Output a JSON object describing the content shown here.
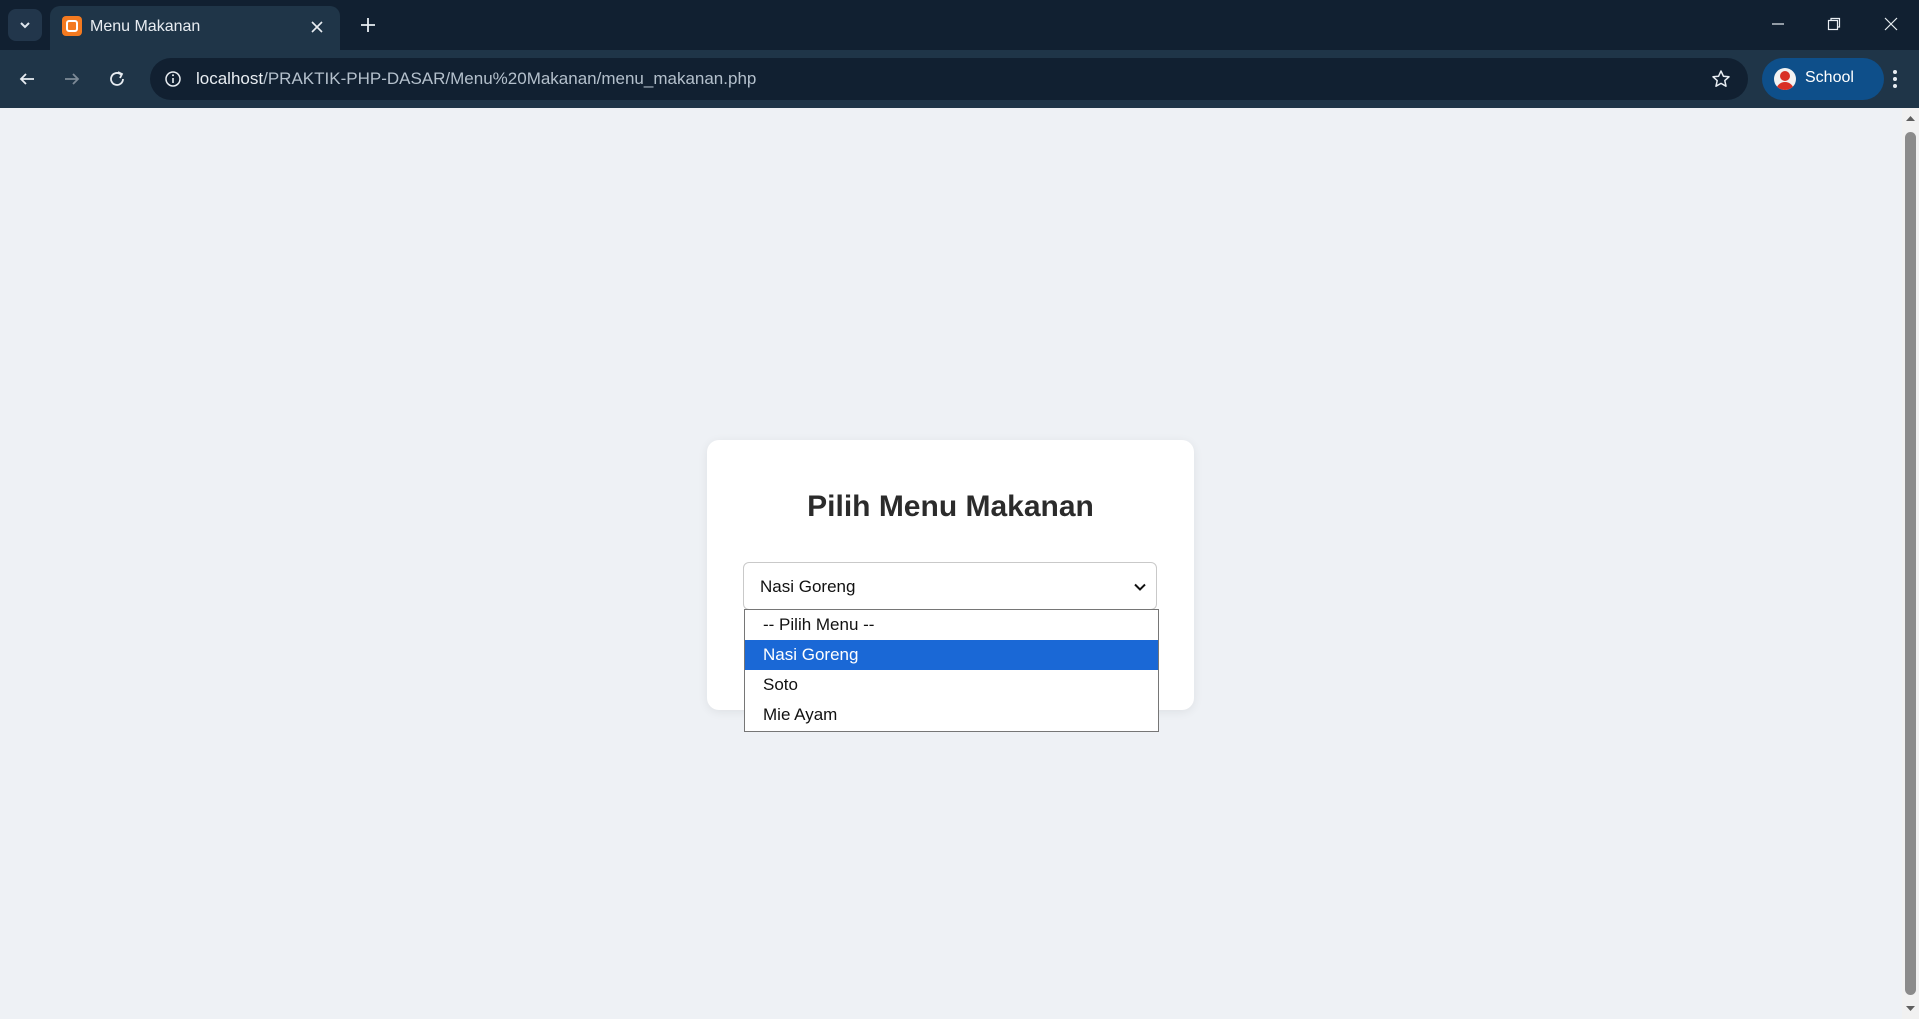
{
  "browser": {
    "tab_title": "Menu Makanan",
    "url_host": "localhost",
    "url_path": "/PRAKTIK-PHP-DASAR/Menu%20Makanan/menu_makanan.php",
    "profile_label": "School"
  },
  "page": {
    "heading": "Pilih Menu Makanan",
    "select": {
      "value": "Nasi Goreng",
      "options": [
        "-- Pilih Menu --",
        "Nasi Goreng",
        "Soto",
        "Mie Ayam"
      ],
      "selected_index": 1
    }
  },
  "colors": {
    "chrome_dark": "#112031",
    "chrome_toolbar": "#1f3548",
    "page_bg": "#eef1f5",
    "option_highlight": "#1a68d6",
    "profile_bg": "#0e4f8a"
  },
  "icons": [
    "tab-search-icon",
    "favicon-icon",
    "close-icon",
    "plus-icon",
    "minimize-icon",
    "restore-icon",
    "window-close-icon",
    "back-arrow-icon",
    "forward-arrow-icon",
    "reload-icon",
    "site-info-icon",
    "bookmark-star-icon",
    "avatar-icon",
    "kebab-menu-icon",
    "chevron-down-icon"
  ]
}
